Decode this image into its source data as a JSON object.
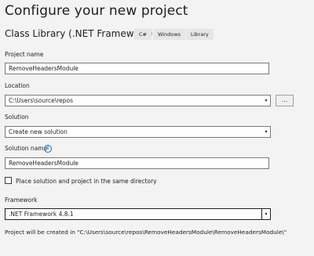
{
  "header": {
    "title": "Configure your new project",
    "template_name": "Class Library (.NET Framework)",
    "tags": [
      "C#",
      "Windows",
      "Library"
    ]
  },
  "form": {
    "project_name": {
      "label": "Project name",
      "value": "RemoveHeadersModule"
    },
    "location": {
      "label": "Location",
      "value": "C:\\Users\\source\\repos",
      "browse_label": "..."
    },
    "solution": {
      "label": "Solution",
      "value": "Create new solution"
    },
    "solution_name": {
      "label": "Solution name",
      "value": "RemoveHeadersModule",
      "info_glyph": "i"
    },
    "same_directory": {
      "label": "Place solution and project in the same directory",
      "checked": false
    },
    "framework": {
      "label": "Framework",
      "value": ".NET Framework 4.8.1"
    }
  },
  "footer": {
    "path_text": "Project will be created in \"C:\\Users\\source\\repos\\RemoveHeadersModule\\RemoveHeadersModule\\\""
  },
  "icons": {
    "dropdown_caret": "▾",
    "info": "info-icon"
  },
  "colors": {
    "background": "#f3f3f3",
    "field_border": "#7a7a7a",
    "info_blue": "#1a6cc7",
    "tag_bg": "#e6e6e6"
  }
}
